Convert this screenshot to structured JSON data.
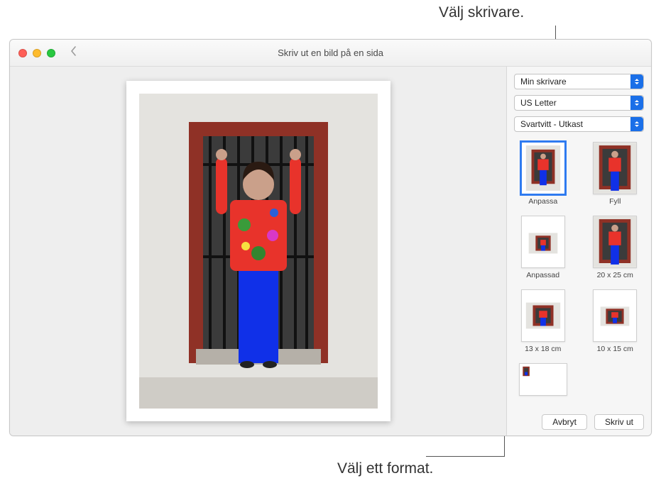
{
  "callouts": {
    "top": "Välj skrivare.",
    "bottom": "Välj ett format."
  },
  "window": {
    "title": "Skriv ut  en bild på en sida"
  },
  "sidebar": {
    "printer": {
      "value": "Min skrivare"
    },
    "paper": {
      "value": "US Letter"
    },
    "mode": {
      "value": "Svartvitt - Utkast"
    },
    "formats": [
      {
        "label": "Anpassa",
        "selected": true,
        "fit": "contain"
      },
      {
        "label": "Fyll",
        "selected": false,
        "fit": "cover"
      },
      {
        "label": "Anpassad",
        "selected": false,
        "fit": "small-land"
      },
      {
        "label": "20 x 25 cm",
        "selected": false,
        "fit": "cover"
      },
      {
        "label": "13 x 18 cm",
        "selected": false,
        "fit": "med-land"
      },
      {
        "label": "10 x 15 cm",
        "selected": false,
        "fit": "tiny-land"
      },
      {
        "label": "",
        "selected": false,
        "fit": "corner"
      }
    ],
    "buttons": {
      "cancel": "Avbryt",
      "print": "Skriv ut"
    }
  }
}
